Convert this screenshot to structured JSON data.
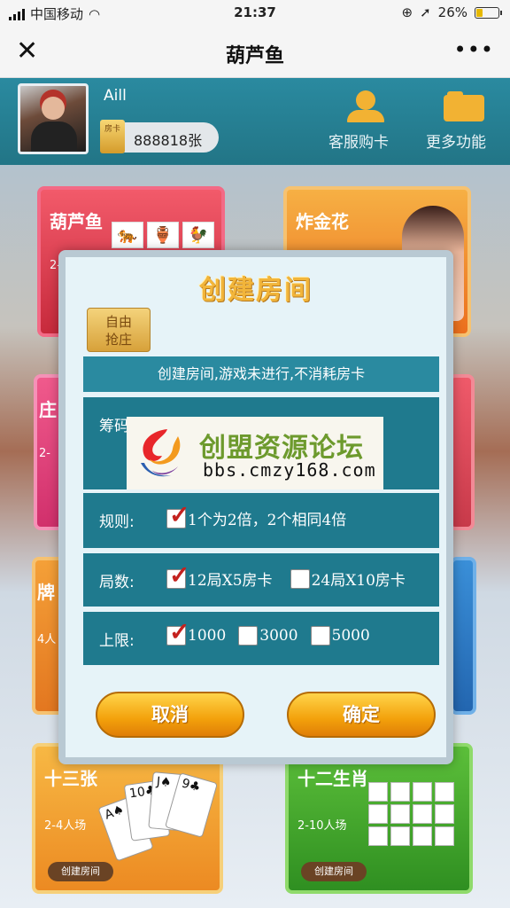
{
  "status_bar": {
    "carrier": "中国移动",
    "time": "21:37",
    "battery": "26%",
    "battery_level": 0.26,
    "battery_color": "#e6b800"
  },
  "nav": {
    "title": "葫芦鱼",
    "close_icon": "close-icon",
    "more_icon": "more-dots-icon"
  },
  "header": {
    "user_name": "Aill",
    "card_badge": "房卡",
    "card_count": "888818张",
    "service_label": "客服购卡",
    "more_label": "更多功能"
  },
  "menu": {
    "hulu": {
      "title": "葫芦鱼",
      "sub": "2-"
    },
    "zjh": {
      "title": "炸金花"
    },
    "left2": {
      "title": "庄",
      "sub": "2-"
    },
    "left3": {
      "title": "牌",
      "sub": "4人"
    },
    "shisanzhang": {
      "title": "十三张",
      "sub": "2-4人场",
      "button": "创建房间"
    },
    "shengxiao": {
      "title": "十二生肖",
      "sub": "2-10人场",
      "button": "创建房间"
    }
  },
  "dialog": {
    "title": "创建房间",
    "tab_free": "自由\n抢庄",
    "notice": "创建房间,游戏未进行,不消耗房卡",
    "chips": {
      "label": "筹码"
    },
    "rules": {
      "label": "规则:",
      "options": [
        {
          "text": "1个为2倍，2个相同4倍",
          "checked": true
        }
      ]
    },
    "rounds": {
      "label": "局数:",
      "options": [
        {
          "text": "12局X5房卡",
          "checked": true
        },
        {
          "text": "24局X10房卡",
          "checked": false
        }
      ]
    },
    "limit": {
      "label": "上限:",
      "options": [
        {
          "text": "1000",
          "checked": true
        },
        {
          "text": "3000",
          "checked": false
        },
        {
          "text": "5000",
          "checked": false
        }
      ]
    },
    "cancel": "取消",
    "confirm": "确定"
  },
  "watermark": {
    "cn": "创盟资源论坛",
    "url": "bbs.cmzy168.com"
  },
  "colors": {
    "accent_teal": "#2a8aa0",
    "button_orange": "#f3a10b",
    "title_gold": "#f2b53a"
  }
}
